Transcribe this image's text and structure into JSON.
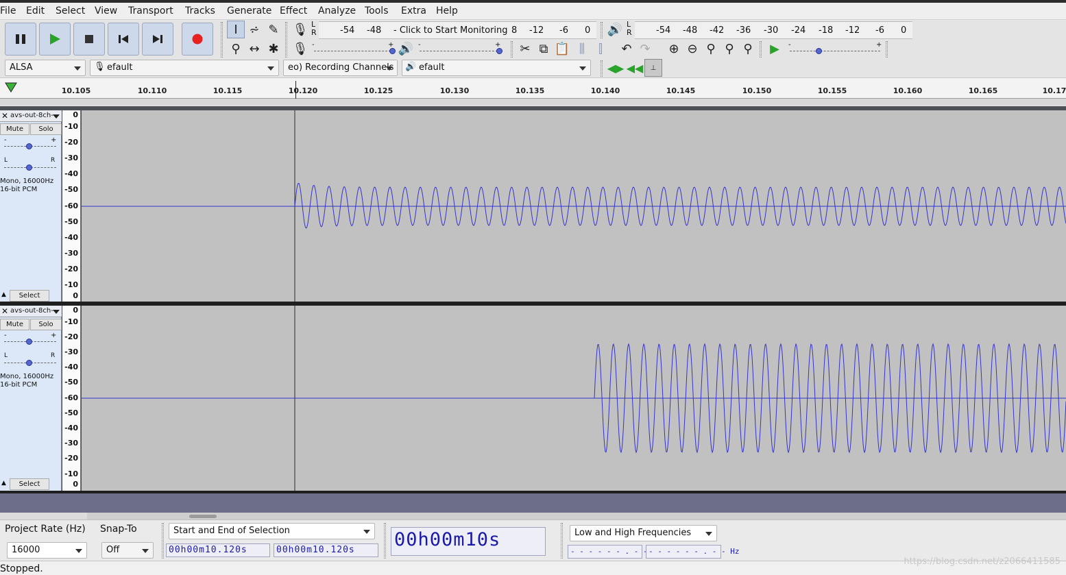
{
  "menu": [
    "File",
    "Edit",
    "Select",
    "View",
    "Transport",
    "Tracks",
    "Generate",
    "Effect",
    "Analyze",
    "Tools",
    "Extra",
    "Help"
  ],
  "meters": {
    "record_ticks": [
      "-54",
      "-48"
    ],
    "monitor_label": "Click to Start Monitoring",
    "record_ticks_right": [
      "-12",
      "-6",
      "0"
    ],
    "play_ticks": [
      "-54",
      "-48",
      "-42",
      "-36",
      "-30",
      "-24",
      "-18",
      "-12",
      "-6",
      "0"
    ],
    "lr_top": "L",
    "lr_bottom": "R",
    "lr_frag": "8"
  },
  "sliders": {
    "minus": "-",
    "plus": "+"
  },
  "devices": {
    "host": "ALSA",
    "recording_device": "efault",
    "channels": "eo) Recording Channels",
    "playback_device": "efault"
  },
  "ruler": [
    "10.105",
    "10.110",
    "10.115",
    "10.120",
    "10.125",
    "10.130",
    "10.135",
    "10.140",
    "10.145",
    "10.150",
    "10.155",
    "10.160",
    "10.165",
    "10.17"
  ],
  "tracks": [
    {
      "name": "avs-out-8ch-",
      "mute": "Mute",
      "solo": "Solo",
      "gain_minus": "-",
      "gain_plus": "+",
      "pan_l": "L",
      "pan_r": "R",
      "info1": "Mono, 16000Hz",
      "info2": "16-bit PCM",
      "select": "Select"
    },
    {
      "name": "avs-out-8ch-",
      "mute": "Mute",
      "solo": "Solo",
      "gain_minus": "-",
      "gain_plus": "+",
      "pan_l": "L",
      "pan_r": "R",
      "info1": "Mono, 16000Hz",
      "info2": "16-bit PCM",
      "select": "Select"
    }
  ],
  "vscale": [
    "0",
    "-10",
    "-20",
    "-30",
    "-40",
    "-50",
    "-60",
    "-50",
    "-40",
    "-30",
    "-20",
    "-10",
    "0"
  ],
  "selection_toolbar": {
    "project_rate_label": "Project Rate (Hz)",
    "project_rate": "16000",
    "snap_label": "Snap-To",
    "snap": "Off",
    "selection_mode": "Start and End of Selection",
    "start_time": "00h00m10.120s",
    "end_time": "00h00m10.120s",
    "audio_position": "00h00m10s"
  },
  "spectral": {
    "mode": "Low and High Frequencies",
    "low": "- - - - - - . - - Hz",
    "high": "- - - - - - . - - Hz"
  },
  "status": "Stopped.",
  "watermark": "https://blog.csdn.net/z2066411585",
  "colors": {
    "waveform": "#3333cc",
    "record_button": "#e82020",
    "play_green": "#2aa32a"
  }
}
